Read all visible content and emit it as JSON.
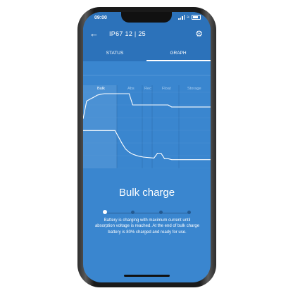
{
  "status_bar": {
    "time": "09:00"
  },
  "app_bar": {
    "title": "IP67 12 | 25"
  },
  "tabs": [
    {
      "label": "STATUS",
      "active": false
    },
    {
      "label": "GRAPH",
      "active": true
    }
  ],
  "chart_data": {
    "type": "line",
    "title": "",
    "xlabel": "",
    "ylabel": "",
    "phases": [
      "Bulk",
      "Abs",
      "Rec",
      "Float",
      "Storage"
    ],
    "active_phase": "Bulk",
    "series": [
      {
        "values": [
          0.15,
          0.75,
          0.82,
          0.88,
          0.95,
          0.98,
          1.0,
          1.0,
          1.0,
          1.0,
          1.0,
          1.0,
          1.0,
          1.0,
          0.62,
          0.62,
          0.62,
          0.62,
          0.62,
          0.62,
          0.62,
          0.62,
          0.62,
          0.62,
          0.62,
          0.55,
          0.55,
          0.55,
          0.55,
          0.55,
          0.55,
          0.55,
          0.55,
          0.55,
          0.55,
          0.55,
          0.55
        ]
      },
      {
        "values": [
          0.95,
          0.95,
          0.95,
          0.95,
          0.95,
          0.95,
          0.95,
          0.95,
          0.95,
          0.95,
          0.75,
          0.55,
          0.38,
          0.28,
          0.22,
          0.18,
          0.15,
          0.13,
          0.12,
          0.11,
          0.1,
          0.25,
          0.25,
          0.08,
          0.08,
          0.05,
          0.05,
          0.05,
          0.05,
          0.05,
          0.05,
          0.05,
          0.05,
          0.05,
          0.05,
          0.05,
          0.05
        ]
      }
    ]
  },
  "phase_detail": {
    "heading": "Bulk charge",
    "description": "Battery is charging with maximum current until absorption voltage is reached. At the end of bulk charge battery is 80% charged and ready for use.",
    "step_count": 4,
    "active_step": 0
  },
  "colors": {
    "screen_bg": "#3a86cf",
    "bar_bg": "#2c72ba",
    "highlight_bg": "#5a9ad9",
    "line": "#ffffff"
  }
}
